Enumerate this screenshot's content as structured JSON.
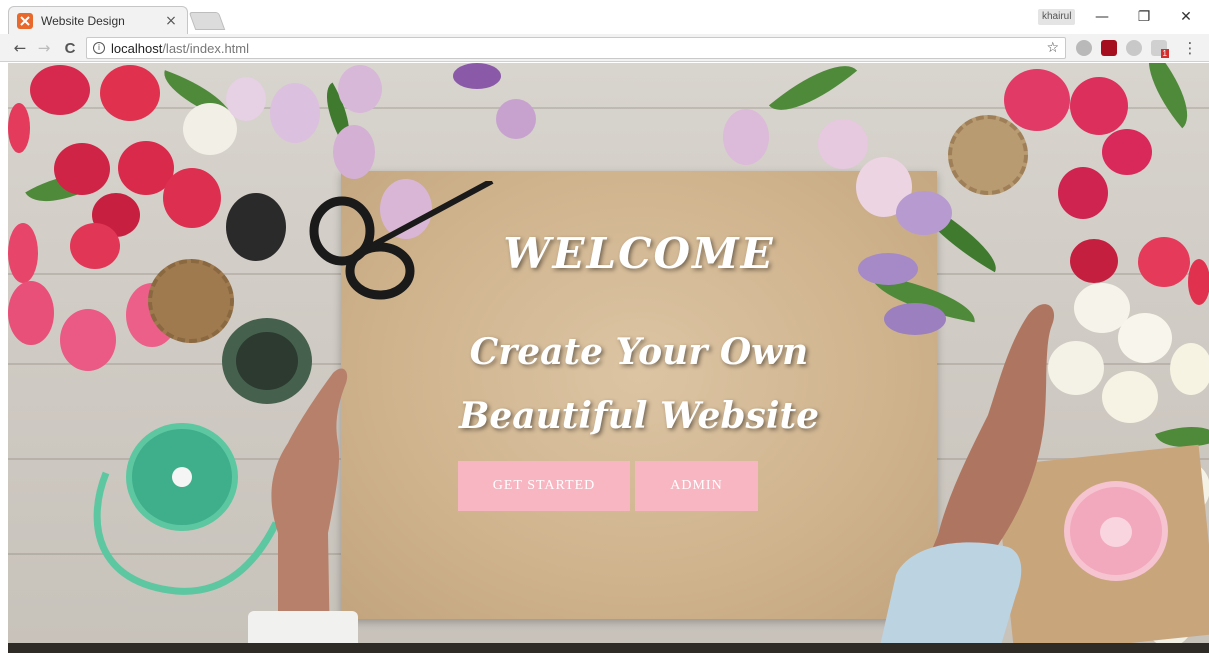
{
  "browser": {
    "tab": {
      "title": "Website Design",
      "close": "×"
    },
    "profile": "khairul",
    "window_controls": {
      "minimize": "—",
      "maximize": "❐",
      "close": "✕"
    },
    "nav": {
      "back": "←",
      "forward": "→",
      "reload": "C"
    },
    "address": {
      "host": "localhost",
      "path": "/last/index.html"
    },
    "star": "☆",
    "menu": "⋮",
    "extension_badge": "1"
  },
  "hero": {
    "welcome": "WELCOME",
    "line1": "Create Your Own",
    "line2": "Beautiful Website",
    "buttons": {
      "get_started": "GET STARTED",
      "admin": "ADMIN"
    }
  },
  "colors": {
    "button_pink": "#f7b6c1",
    "paper": "#cfb38d",
    "tab_favicon": "#e9692c"
  }
}
